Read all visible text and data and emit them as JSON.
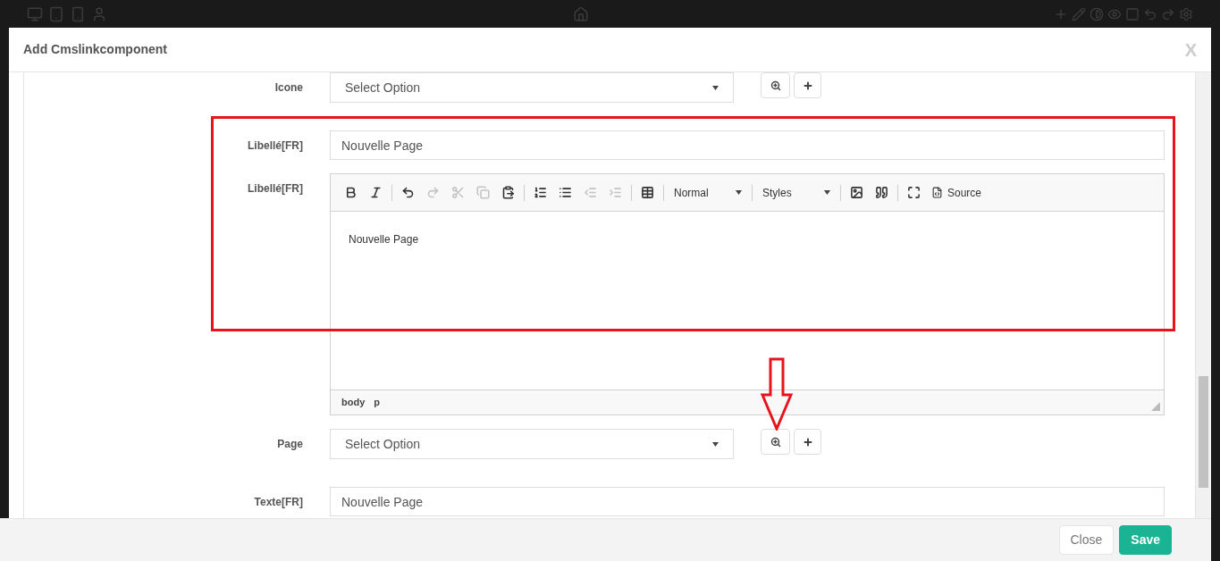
{
  "window": {
    "title": "Add Cmslinkcomponent",
    "close": "X"
  },
  "fields": [
    {
      "kind": "select",
      "label": "Icone",
      "value": "Select Option"
    },
    {
      "kind": "text",
      "label": "Libellé[FR]",
      "value": "Nouvelle Page"
    },
    {
      "kind": "editor",
      "label": "Libellé[FR]",
      "format": "Normal",
      "styles": "Styles",
      "source": "Source",
      "content": "Nouvelle Page",
      "path": [
        "body",
        "p"
      ],
      "tools": [
        {
          "kind": "bold",
          "disabled": false
        },
        {
          "kind": "italic",
          "disabled": false
        },
        {
          "kind": "sep"
        },
        {
          "kind": "undo",
          "disabled": false
        },
        {
          "kind": "redo",
          "disabled": true
        },
        {
          "kind": "cut",
          "disabled": true
        },
        {
          "kind": "copy",
          "disabled": true
        },
        {
          "kind": "paste",
          "disabled": false
        },
        {
          "kind": "sep"
        },
        {
          "kind": "ordered",
          "disabled": false
        },
        {
          "kind": "bullets",
          "disabled": false
        },
        {
          "kind": "outdent",
          "disabled": true
        },
        {
          "kind": "indent",
          "disabled": true
        },
        {
          "kind": "sep"
        },
        {
          "kind": "table",
          "disabled": false
        },
        {
          "kind": "sep"
        },
        {
          "kind": "format"
        },
        {
          "kind": "sep"
        },
        {
          "kind": "styles"
        },
        {
          "kind": "sep"
        },
        {
          "kind": "image",
          "disabled": false
        },
        {
          "kind": "quote",
          "disabled": false
        },
        {
          "kind": "sep"
        },
        {
          "kind": "maximize",
          "disabled": false
        },
        {
          "kind": "source",
          "disabled": false
        }
      ]
    },
    {
      "kind": "select",
      "label": "Page",
      "value": "Select Option"
    },
    {
      "kind": "text",
      "label": "Texte[FR]",
      "value": "Nouvelle Page"
    }
  ],
  "buttons": [
    {
      "kind": "default",
      "label": "Close"
    },
    {
      "kind": "primary",
      "label": "Save"
    }
  ]
}
